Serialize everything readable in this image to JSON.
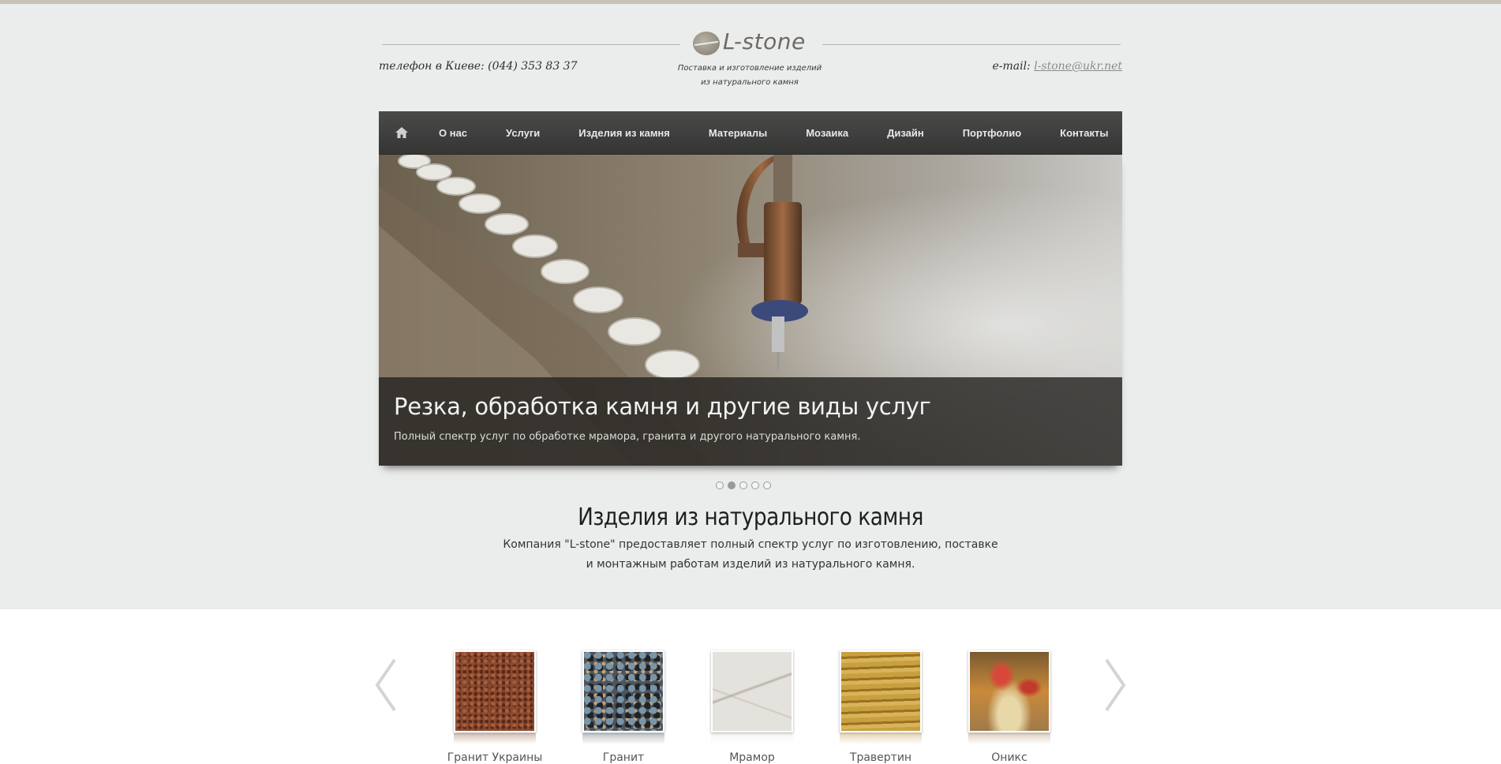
{
  "header": {
    "logo_text": "L-stone",
    "phone": "телефон в Киеве: (044) 353 83 37",
    "tagline_line1": "Поставка и изготовление изделий",
    "tagline_line2": "из натурального камня",
    "email_label": "e-mail:",
    "email": "l-stone@ukr.net"
  },
  "nav": {
    "home_icon": "home-icon",
    "items": [
      {
        "label": "О нас"
      },
      {
        "label": "Услуги"
      },
      {
        "label": "Изделия из камня"
      },
      {
        "label": "Материалы"
      },
      {
        "label": "Мозаика"
      },
      {
        "label": "Дизайн"
      },
      {
        "label": "Портфолио"
      },
      {
        "label": "Контакты"
      }
    ]
  },
  "slider": {
    "title": "Резка, обработка камня и другие виды услуг",
    "subtitle": "Полный спектр услуг по обработке мрамора, гранита и другого натурального камня.",
    "slide_count": 5,
    "active_index": 1
  },
  "intro": {
    "title": "Изделия из натурального камня",
    "text": "Компания \"L-stone\" предоставляет полный спектр услуг по изготовлению, поставке и монтажным работам изделий из натурального камня."
  },
  "materials": {
    "prev_icon": "chevron-left-icon",
    "next_icon": "chevron-right-icon",
    "items": [
      {
        "label": "Гранит Украины",
        "color": "#8a4a30"
      },
      {
        "label": "Гранит",
        "color": "#4a5560"
      },
      {
        "label": "Мрамор",
        "color": "#e4e2dd"
      },
      {
        "label": "Травертин",
        "color": "#b58a2a"
      },
      {
        "label": "Оникс",
        "color": "#c98a3a"
      }
    ]
  },
  "colors": {
    "page_bg": "#ebedec",
    "nav_bg": "#3f3f3e",
    "accent": "#c7c2b6"
  }
}
